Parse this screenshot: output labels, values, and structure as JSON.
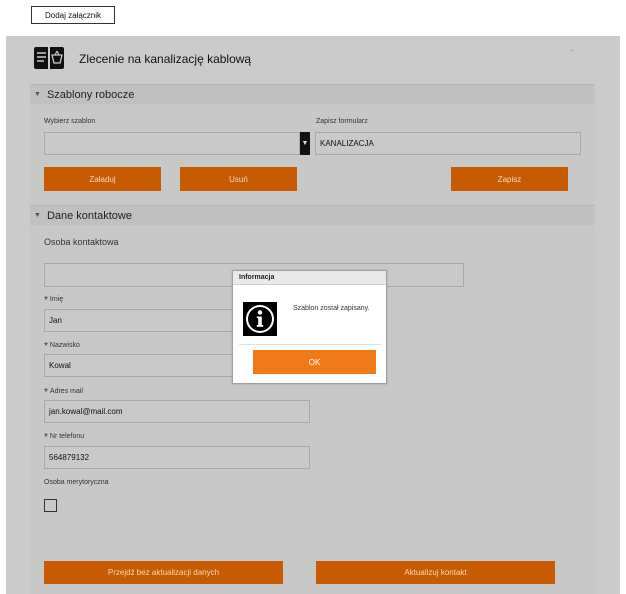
{
  "top": {
    "attach_label": "Dodaj załącznik"
  },
  "header": {
    "title": "Zlecenie na kanalizację kablową"
  },
  "templates": {
    "section_title": "Szablony robocze",
    "choose_label": "Wybierz szablon",
    "choose_value": "",
    "save_form_label": "Zapisz formularz",
    "save_form_value": "KANALIZACJA",
    "load_label": "Załaduj",
    "remove_label": "Usuń",
    "save_label": "Zapisz"
  },
  "contact": {
    "section_title": "Dane kontaktowe",
    "person_label": "Osoba kontaktowa",
    "person_value": "",
    "required_mark": "*",
    "first_name_label": "Imię",
    "first_name_value": "Jan",
    "last_name_label": "Nazwisko",
    "last_name_value": "Kowal",
    "email_label": "Adres mail",
    "email_value": "jan.kowal@mail.com",
    "phone_label": "Nr telefonu",
    "phone_value": "564879132",
    "merit_label": "Osoba merytoryczna",
    "skip_label": "Przejdź bez aktualizacji danych",
    "update_label": "Aktualizuj kontakt"
  },
  "dialog": {
    "title": "Informacja",
    "message": "Szablon został zapisany.",
    "ok_label": "OK"
  }
}
